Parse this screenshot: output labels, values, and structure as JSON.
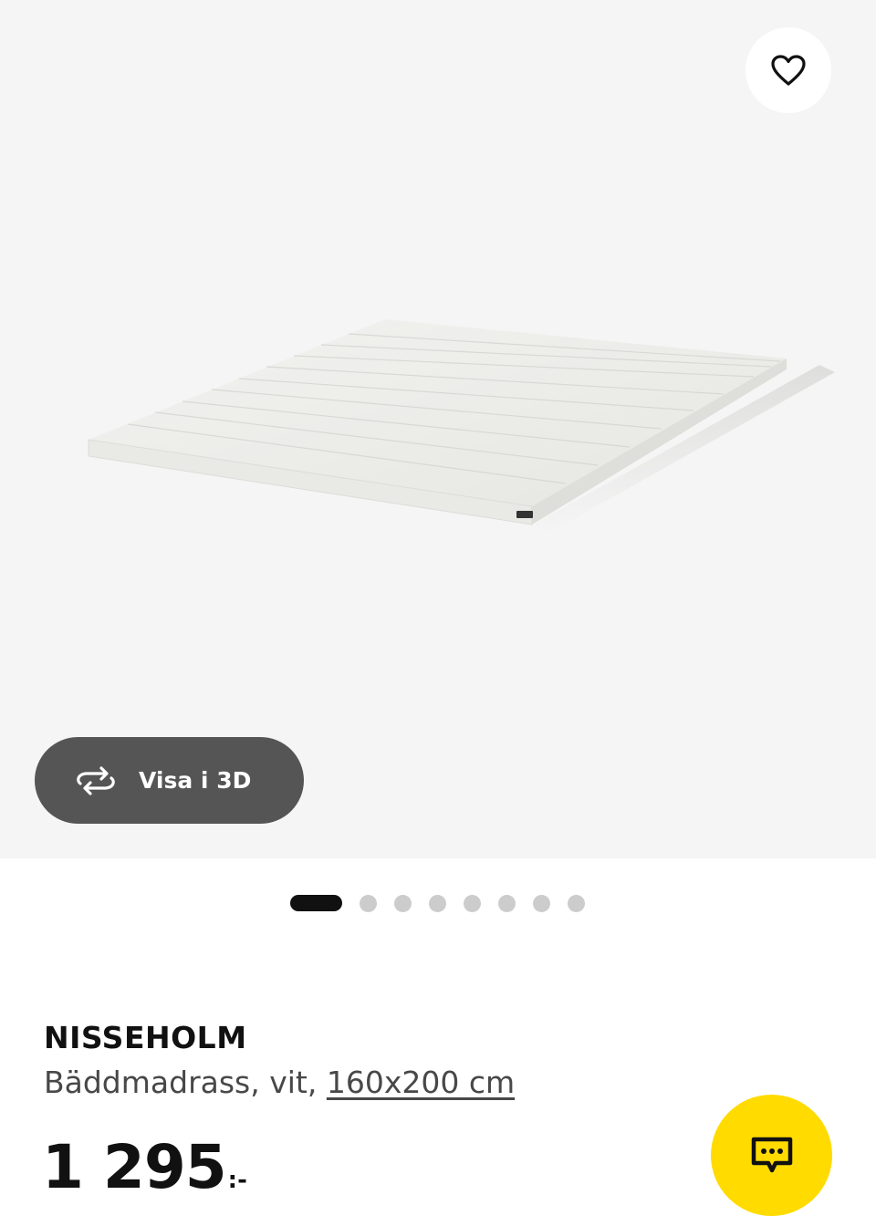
{
  "gallery": {
    "view3d_label": "Visa i 3D",
    "total_images": 8,
    "active_index": 0
  },
  "product": {
    "name": "NISSEHOLM",
    "description": "Bäddmadrass, vit, ",
    "size": "160x200 cm",
    "price": "1 295",
    "price_suffix": ":-"
  },
  "colors": {
    "accent_yellow": "#ffdb00",
    "button_dark": "#555555",
    "text": "#111111"
  },
  "icons": {
    "favorite": "heart-icon",
    "view3d": "rotate-3d-icon",
    "chat": "chat-bubble-icon"
  }
}
